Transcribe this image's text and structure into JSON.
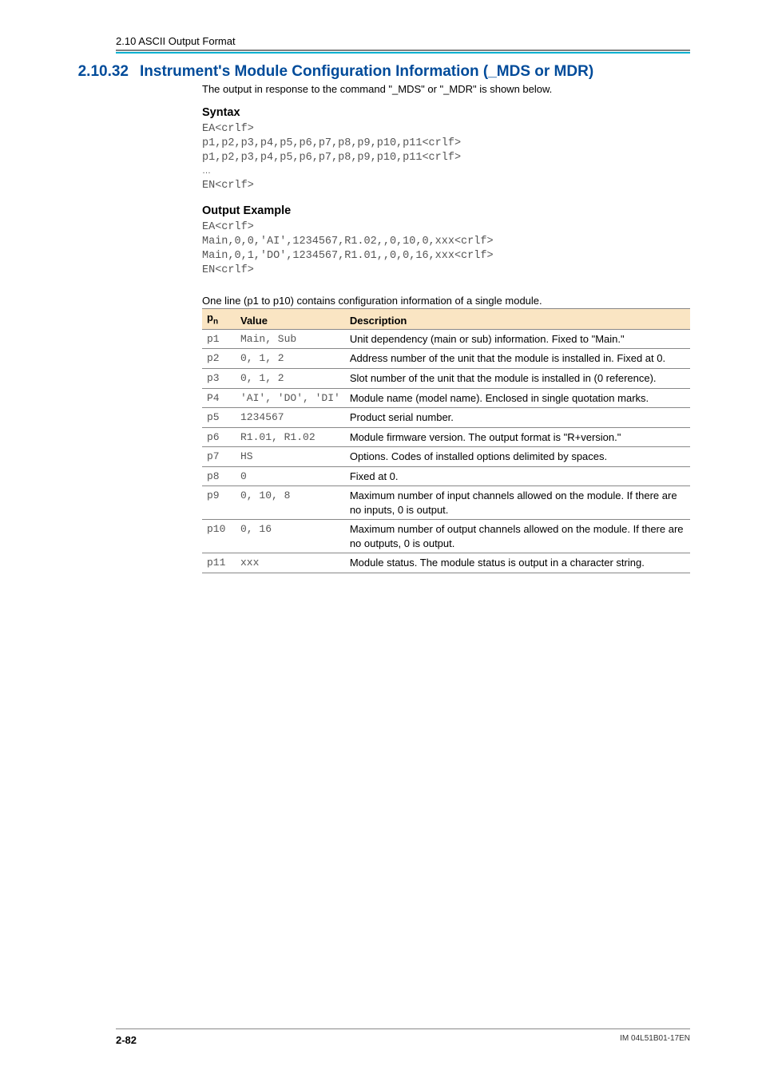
{
  "runhead": "2.10  ASCII Output Format",
  "section": {
    "number": "2.10.32",
    "title": "Instrument's Module Configuration Information (_MDS or MDR)"
  },
  "intro": "The output in response to the command \"_MDS\" or \"_MDR\" is shown below.",
  "syntax": {
    "heading": "Syntax",
    "lines": [
      "EA<crlf>",
      "p1,p2,p3,p4,p5,p6,p7,p8,p9,p10,p11<crlf>",
      "p1,p2,p3,p4,p5,p6,p7,p8,p9,p10,p11<crlf>",
      "…",
      "EN<crlf>"
    ]
  },
  "example": {
    "heading": "Output Example",
    "lines": [
      "EA<crlf>",
      "Main,0,0,'AI',1234567,R1.02,,0,10,0,xxx<crlf>",
      "Main,0,1,'DO',1234567,R1.01,,0,0,16,xxx<crlf>",
      "EN<crlf>"
    ]
  },
  "table_caption": "One line (p1 to p10) contains configuration information of a single module.",
  "table": {
    "headers": {
      "pn": "p",
      "pnsub": "n",
      "value": "Value",
      "desc": "Description"
    },
    "rows": [
      {
        "pn": "p1",
        "value": "Main, Sub",
        "desc": "Unit dependency (main or sub) information. Fixed to \"Main.\""
      },
      {
        "pn": "p2",
        "value": "0, 1, 2",
        "desc": "Address number of the unit that the module is installed in. Fixed at 0."
      },
      {
        "pn": "p3",
        "value": "0, 1, 2",
        "desc": "Slot number of the unit that the module is installed in (0 reference)."
      },
      {
        "pn": "P4",
        "value": "'AI', 'DO', 'DI'",
        "desc": "Module name (model name). Enclosed in single quotation marks."
      },
      {
        "pn": "p5",
        "value": "1234567",
        "desc": "Product serial number."
      },
      {
        "pn": "p6",
        "value": "R1.01, R1.02",
        "desc": "Module firmware version. The output format is \"R+version.\""
      },
      {
        "pn": "p7",
        "value": "HS",
        "desc": "Options. Codes of installed options delimited by spaces."
      },
      {
        "pn": "p8",
        "value": "0",
        "desc": "Fixed at 0."
      },
      {
        "pn": "p9",
        "value": "0, 10, 8",
        "desc": "Maximum number of input channels allowed on the module. If there are no inputs, 0 is output."
      },
      {
        "pn": "p10",
        "value": "0, 16",
        "desc": "Maximum number of output channels allowed on the module. If there are no outputs, 0 is output."
      },
      {
        "pn": "p11",
        "value": "xxx",
        "desc": "Module status. The module status is output in a character string."
      }
    ]
  },
  "footer": {
    "page": "2-82",
    "doc": "IM 04L51B01-17EN"
  }
}
